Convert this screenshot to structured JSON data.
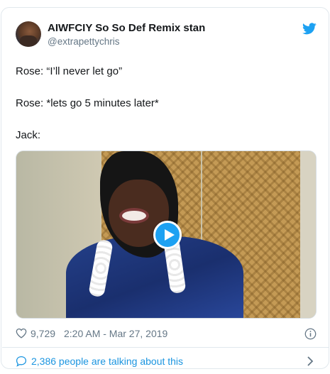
{
  "author": {
    "name": "AIWFCIY So So Def Remix stan",
    "handle": "@extrapettychris"
  },
  "tweet": {
    "lines": [
      "Rose: “I’ll never let go”",
      "Rose: *lets go 5 minutes later*",
      "Jack:"
    ]
  },
  "media": {
    "type": "video",
    "play_icon": "play-icon"
  },
  "meta": {
    "likes": "9,729",
    "timestamp": "2:20 AM - Mar 27, 2019"
  },
  "conversation": {
    "label": "2,386 people are talking about this"
  },
  "icons": {
    "brand": "twitter-bird-icon",
    "like": "heart-icon",
    "info": "info-icon",
    "conversation": "speech-bubble-icon",
    "more": "chevron-right-icon"
  },
  "colors": {
    "accent": "#1da1f2",
    "link": "#1b95e0",
    "muted": "#657786",
    "border": "#e1e8ed"
  }
}
